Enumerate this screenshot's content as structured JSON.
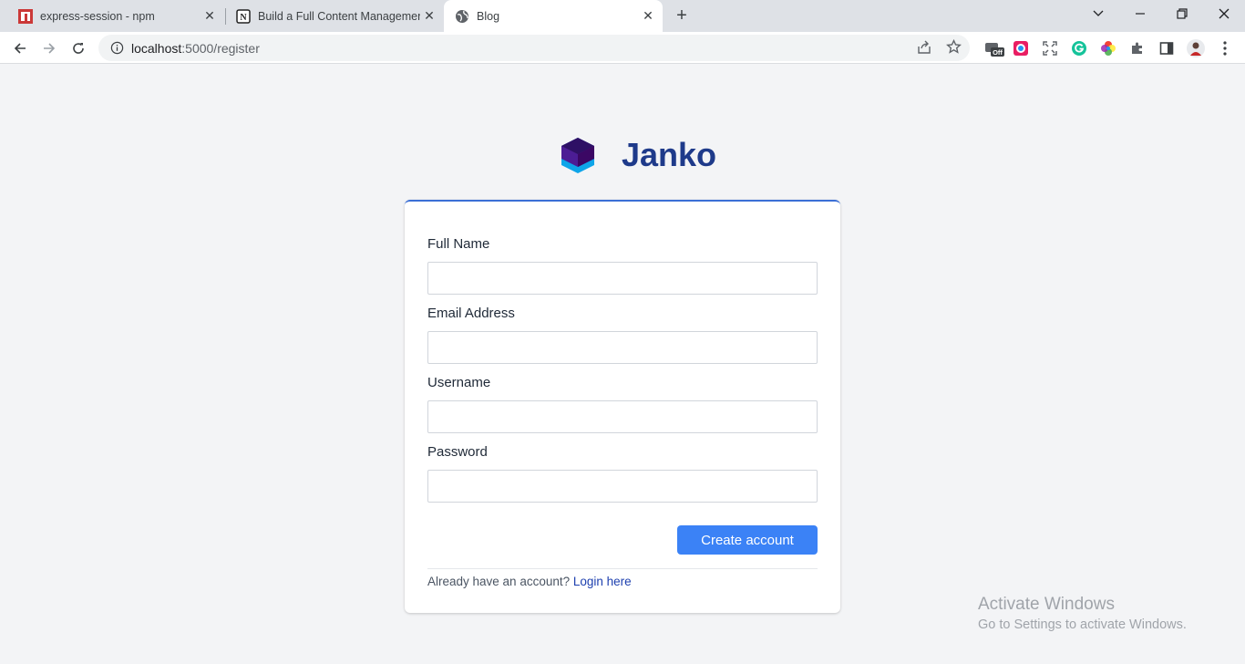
{
  "browser": {
    "tabs": [
      {
        "title": "express-session - npm",
        "icon": "npm-icon",
        "active": false
      },
      {
        "title": "Build a Full Content Management",
        "icon": "notion-icon",
        "active": false
      },
      {
        "title": "Blog",
        "icon": "globe-icon",
        "active": true
      }
    ],
    "close_glyph": "✕",
    "new_tab_glyph": "+",
    "address": {
      "host": "localhost",
      "path": ":5000/register"
    },
    "window_controls": {
      "chevron": "⌄",
      "minimize": "—",
      "restore": "❐",
      "close": "✕"
    },
    "extensions": [
      "off-extension-icon",
      "color-picker-icon",
      "fullscreen-icon",
      "grammarly-icon",
      "color-wheel-icon",
      "puzzle-icon",
      "side-panel-icon",
      "profile-avatar",
      "menu-dots-icon"
    ],
    "extension_badge": "Off"
  },
  "brand": {
    "name": "Janko",
    "logo_colors": [
      "#2e1065",
      "#4c1d95",
      "#0ea5e9"
    ]
  },
  "form": {
    "fields": [
      {
        "label": "Full Name",
        "value": ""
      },
      {
        "label": "Email Address",
        "value": ""
      },
      {
        "label": "Username",
        "value": ""
      },
      {
        "label": "Password",
        "value": ""
      }
    ],
    "submit_label": "Create account",
    "footer_text": "Already have an account?",
    "footer_link": "Login here"
  },
  "watermark": {
    "line1": "Activate Windows",
    "line2": "Go to Settings to activate Windows."
  },
  "colors": {
    "accent": "#3b82f6",
    "brand": "#1e3a8a",
    "background": "#f3f4f6"
  }
}
